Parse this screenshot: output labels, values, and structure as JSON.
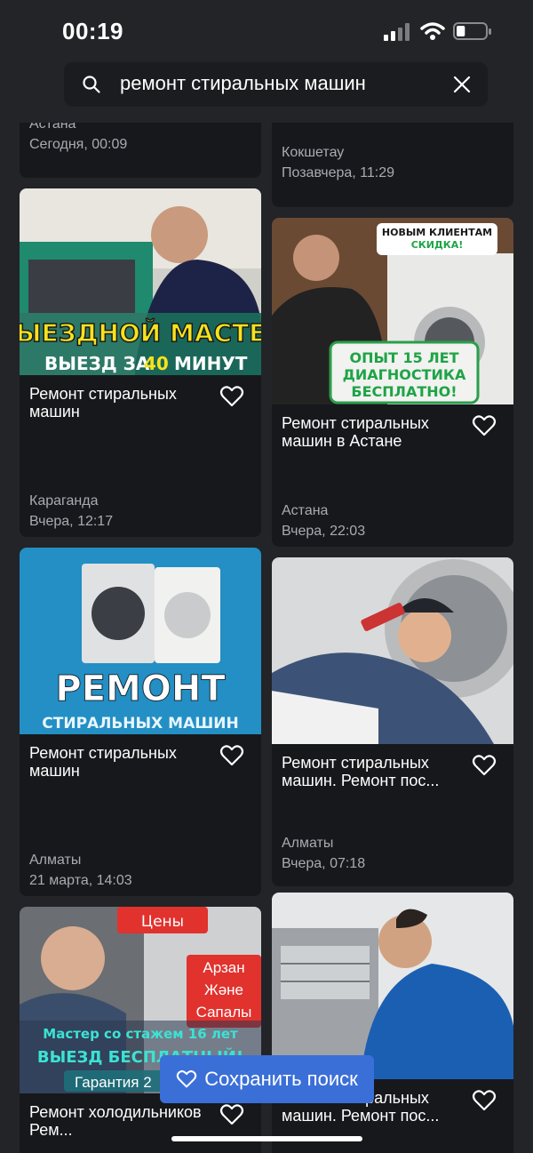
{
  "status_bar": {
    "time": "00:19",
    "battery_level": 0.3
  },
  "search": {
    "query": "ремонт стиральных машин"
  },
  "listings_top_partial": [
    {
      "city": "Астана",
      "date": "Сегодня, 00:09"
    },
    {
      "city": "Кокшетау",
      "date": "Позавчера, 11:29"
    }
  ],
  "listings": [
    {
      "title": "Ремонт стиральных машин",
      "city": "Караганда",
      "date": "Вчера, 12:17",
      "image_text": [
        "ВЫЕЗДНОЙ МАСТЕР",
        "ВЫЕЗД ЗА",
        "40",
        "МИНУТ"
      ]
    },
    {
      "title": "Ремонт стиральных машин в Астане",
      "city": "Астана",
      "date": "Вчера, 22:03",
      "image_text": [
        "НОВЫМ КЛИЕНТАМ",
        "СКИДКА!",
        "ОПЫТ 15 ЛЕТ",
        "ДИАГНОСТИКА",
        "БЕСПЛАТНО!"
      ]
    },
    {
      "title": "Ремонт стиральных машин",
      "city": "Алматы",
      "date": "21 марта, 14:03",
      "image_text": [
        "РЕМОНТ",
        "СТИРАЛЬНЫХ МАШИН"
      ]
    },
    {
      "title": "Ремонт стиральных машин. Ремонт пос...",
      "city": "Алматы",
      "date": "Вчера, 07:18",
      "image_text": []
    },
    {
      "title": "Ремонт холодильников Рем...",
      "image_text": [
        "Цены",
        "Арзан",
        "Жәнe",
        "Сапалы",
        "Мастер со стажем 16 лет",
        "ВЫЕЗД БЕСПЛАТНЫЙ!",
        "Гарантия 2"
      ]
    },
    {
      "title": "Ремонт стиральных машин. Ремонт пос...",
      "image_text": []
    }
  ],
  "save_search": {
    "label": "Сохранить поиск"
  },
  "colors": {
    "background": "#232428",
    "card": "#17181c",
    "accent": "#3b6fd8",
    "muted_text": "#a9abb1"
  },
  "icons": [
    "search-icon",
    "close-icon",
    "heart-icon",
    "signal-icon",
    "wifi-icon",
    "battery-icon"
  ]
}
